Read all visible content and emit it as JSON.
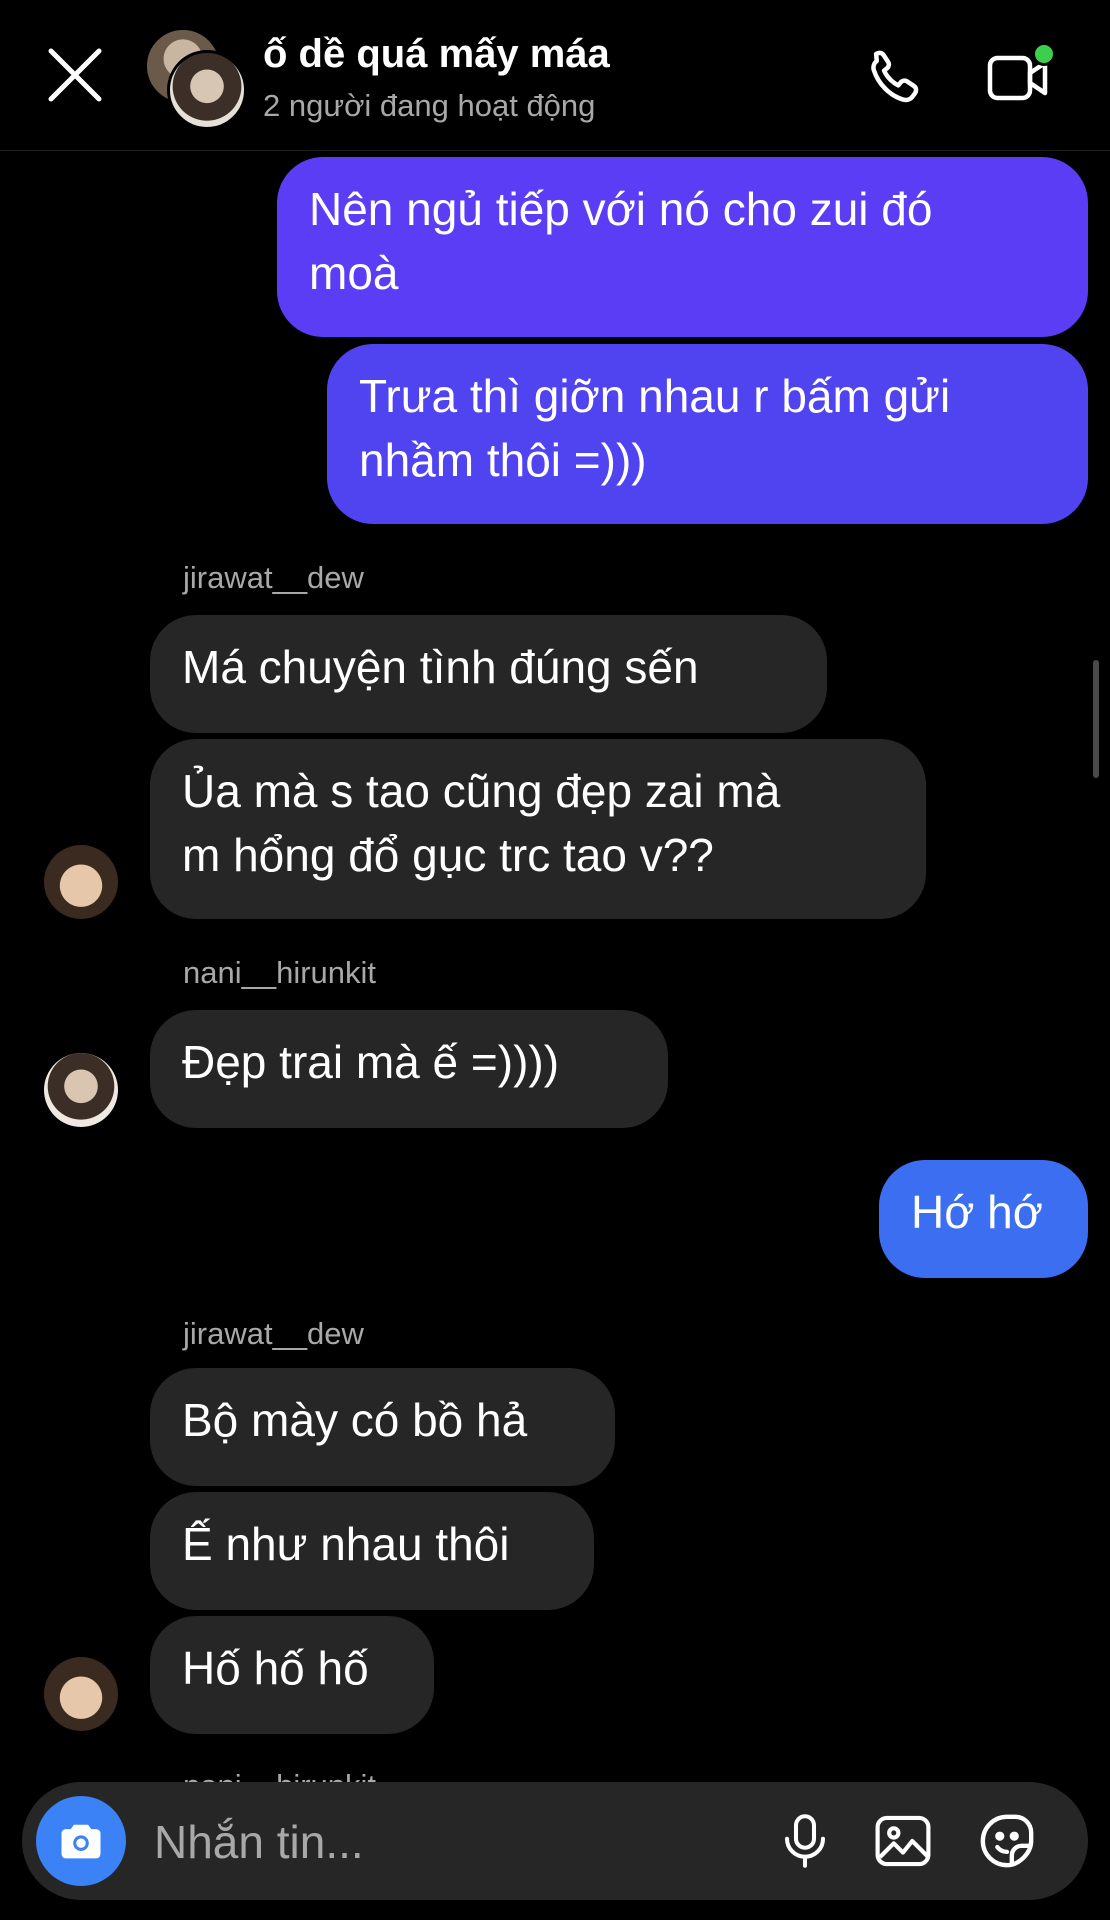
{
  "header": {
    "title": "ố dề quá mấy máa",
    "subtitle": "2 người đang hoạt động",
    "online_indicator_color": "#3ccf4e"
  },
  "messages": [
    {
      "type": "outgoing",
      "lines": [
        "Nên ngủ tiếp với nó cho zui đó",
        "moà"
      ]
    },
    {
      "type": "outgoing",
      "lines": [
        "Trưa thì giỡn nhau r bấm gửi",
        "nhầm thôi =)))"
      ]
    },
    {
      "type": "sender",
      "name": "jirawat__dew"
    },
    {
      "type": "incoming",
      "lines": [
        "Má chuyện tình đúng sến"
      ]
    },
    {
      "type": "incoming",
      "lines": [
        "Ủa mà s tao cũng đẹp zai mà",
        "m hổng đổ gục trc tao v??"
      ]
    },
    {
      "type": "sender",
      "name": "nani__hirunkit"
    },
    {
      "type": "incoming",
      "lines": [
        "Đẹp trai mà ế =))))"
      ]
    },
    {
      "type": "outgoing",
      "lines": [
        "Hớ hớ"
      ]
    },
    {
      "type": "sender",
      "name": "jirawat__dew"
    },
    {
      "type": "incoming",
      "lines": [
        "Bộ mày có bồ hả"
      ]
    },
    {
      "type": "incoming",
      "lines": [
        "Ế như nhau thôi"
      ]
    },
    {
      "type": "incoming",
      "lines": [
        "Hố hố hố"
      ]
    },
    {
      "type": "sender",
      "name": "nani__hirunkit"
    }
  ],
  "composer": {
    "placeholder": "Nhắn tin..."
  },
  "icons": {
    "close": "close-icon",
    "call": "phone-icon",
    "video": "video-icon",
    "camera": "camera-icon",
    "mic": "microphone-icon",
    "gallery": "image-icon",
    "sticker": "sticker-icon"
  },
  "colors": {
    "outgoing_purple": "#5b3df5",
    "outgoing_blue": "#3b6ef0",
    "incoming": "#262626",
    "camera_button": "#3b82f6"
  }
}
